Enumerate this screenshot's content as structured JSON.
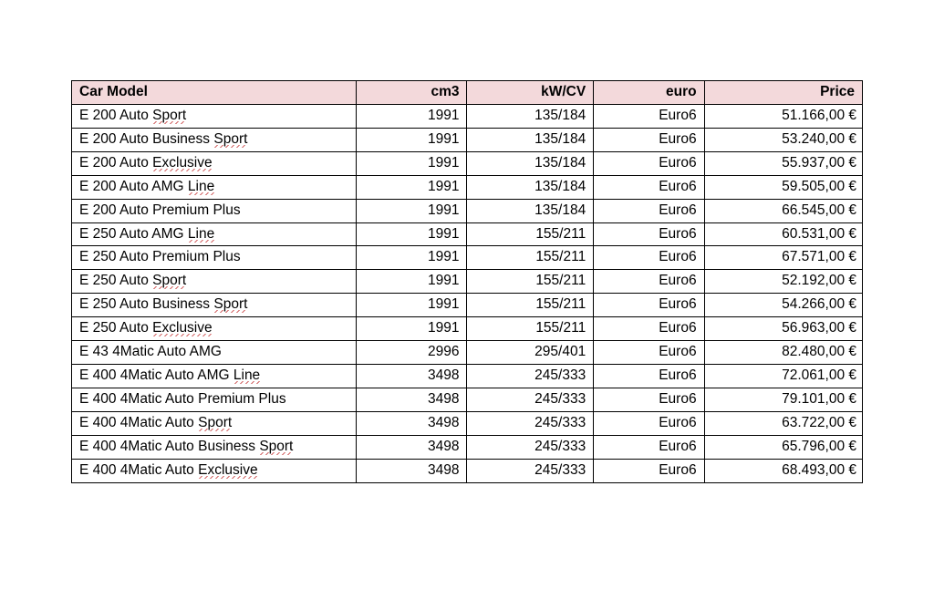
{
  "table": {
    "headers": {
      "model": "Car Model",
      "cm3": "cm3",
      "kwcv": "kW/CV",
      "euro": "euro",
      "price": "Price"
    },
    "rows": [
      {
        "model_pre": "E 200 Auto ",
        "model_sq": "Sport",
        "model_post": "",
        "cm3": "1991",
        "kwcv": "135/184",
        "euro": "Euro6",
        "price": "51.166,00 €"
      },
      {
        "model_pre": "E 200 Auto Business ",
        "model_sq": "Sport",
        "model_post": "",
        "cm3": "1991",
        "kwcv": "135/184",
        "euro": "Euro6",
        "price": "53.240,00 €"
      },
      {
        "model_pre": "E 200 Auto ",
        "model_sq": "Exclusive",
        "model_post": "",
        "cm3": "1991",
        "kwcv": "135/184",
        "euro": "Euro6",
        "price": "55.937,00 €"
      },
      {
        "model_pre": "E 200 Auto AMG ",
        "model_sq": "Line",
        "model_post": "",
        "cm3": "1991",
        "kwcv": "135/184",
        "euro": "Euro6",
        "price": "59.505,00 €"
      },
      {
        "model_pre": "E 200 Auto Premium ",
        "model_sq": "",
        "model_post": "Plus",
        "cm3": "1991",
        "kwcv": "135/184",
        "euro": "Euro6",
        "price": "66.545,00 €"
      },
      {
        "model_pre": "E 250 Auto AMG ",
        "model_sq": "Line",
        "model_post": "",
        "cm3": "1991",
        "kwcv": "155/211",
        "euro": "Euro6",
        "price": "60.531,00 €"
      },
      {
        "model_pre": "E 250 Auto Premium ",
        "model_sq": "",
        "model_post": "Plus",
        "cm3": "1991",
        "kwcv": "155/211",
        "euro": "Euro6",
        "price": "67.571,00 €"
      },
      {
        "model_pre": "E 250 Auto ",
        "model_sq": "Sport",
        "model_post": "",
        "cm3": "1991",
        "kwcv": "155/211",
        "euro": "Euro6",
        "price": "52.192,00 €"
      },
      {
        "model_pre": "E 250 Auto Business ",
        "model_sq": "Sport",
        "model_post": "",
        "cm3": "1991",
        "kwcv": "155/211",
        "euro": "Euro6",
        "price": "54.266,00 €"
      },
      {
        "model_pre": "E 250 Auto ",
        "model_sq": "Exclusive",
        "model_post": "",
        "cm3": "1991",
        "kwcv": "155/211",
        "euro": "Euro6",
        "price": "56.963,00 €"
      },
      {
        "model_pre": "E 43 4Matic Auto AMG",
        "model_sq": "",
        "model_post": "",
        "cm3": "2996",
        "kwcv": "295/401",
        "euro": "Euro6",
        "price": "82.480,00 €"
      },
      {
        "model_pre": "E 400 4Matic Auto AMG ",
        "model_sq": "Line",
        "model_post": "",
        "cm3": "3498",
        "kwcv": "245/333",
        "euro": "Euro6",
        "price": "72.061,00 €"
      },
      {
        "model_pre": "E 400 4Matic Auto Premium ",
        "model_sq": "",
        "model_post": "Plus",
        "cm3": "3498",
        "kwcv": "245/333",
        "euro": "Euro6",
        "price": "79.101,00 €"
      },
      {
        "model_pre": "E 400 4Matic Auto ",
        "model_sq": "Sport",
        "model_post": "",
        "cm3": "3498",
        "kwcv": "245/333",
        "euro": "Euro6",
        "price": "63.722,00 €"
      },
      {
        "model_pre": "E 400 4Matic Auto Business ",
        "model_sq": "Sport",
        "model_post": "",
        "cm3": "3498",
        "kwcv": "245/333",
        "euro": "Euro6",
        "price": "65.796,00 €"
      },
      {
        "model_pre": "E 400 4Matic Auto ",
        "model_sq": "Exclusive",
        "model_post": "",
        "cm3": "3498",
        "kwcv": "245/333",
        "euro": "Euro6",
        "price": "68.493,00 €"
      }
    ]
  },
  "chart_data": {
    "type": "table",
    "columns": [
      "Car Model",
      "cm3",
      "kW/CV",
      "euro",
      "Price"
    ],
    "rows": [
      [
        "E 200 Auto Sport",
        1991,
        "135/184",
        "Euro6",
        "51.166,00 €"
      ],
      [
        "E 200 Auto Business Sport",
        1991,
        "135/184",
        "Euro6",
        "53.240,00 €"
      ],
      [
        "E 200 Auto Exclusive",
        1991,
        "135/184",
        "Euro6",
        "55.937,00 €"
      ],
      [
        "E 200 Auto AMG Line",
        1991,
        "135/184",
        "Euro6",
        "59.505,00 €"
      ],
      [
        "E 200 Auto Premium Plus",
        1991,
        "135/184",
        "Euro6",
        "66.545,00 €"
      ],
      [
        "E 250 Auto AMG Line",
        1991,
        "155/211",
        "Euro6",
        "60.531,00 €"
      ],
      [
        "E 250 Auto Premium Plus",
        1991,
        "155/211",
        "Euro6",
        "67.571,00 €"
      ],
      [
        "E 250 Auto Sport",
        1991,
        "155/211",
        "Euro6",
        "52.192,00 €"
      ],
      [
        "E 250 Auto Business Sport",
        1991,
        "155/211",
        "Euro6",
        "54.266,00 €"
      ],
      [
        "E 250 Auto Exclusive",
        1991,
        "155/211",
        "Euro6",
        "56.963,00 €"
      ],
      [
        "E 43 4Matic Auto AMG",
        2996,
        "295/401",
        "Euro6",
        "82.480,00 €"
      ],
      [
        "E 400 4Matic Auto AMG Line",
        3498,
        "245/333",
        "Euro6",
        "72.061,00 €"
      ],
      [
        "E 400 4Matic Auto Premium Plus",
        3498,
        "245/333",
        "Euro6",
        "79.101,00 €"
      ],
      [
        "E 400 4Matic Auto Sport",
        3498,
        "245/333",
        "Euro6",
        "63.722,00 €"
      ],
      [
        "E 400 4Matic Auto Business Sport",
        3498,
        "245/333",
        "Euro6",
        "65.796,00 €"
      ],
      [
        "E 400 4Matic Auto Exclusive",
        3498,
        "245/333",
        "Euro6",
        "68.493,00 €"
      ]
    ]
  }
}
